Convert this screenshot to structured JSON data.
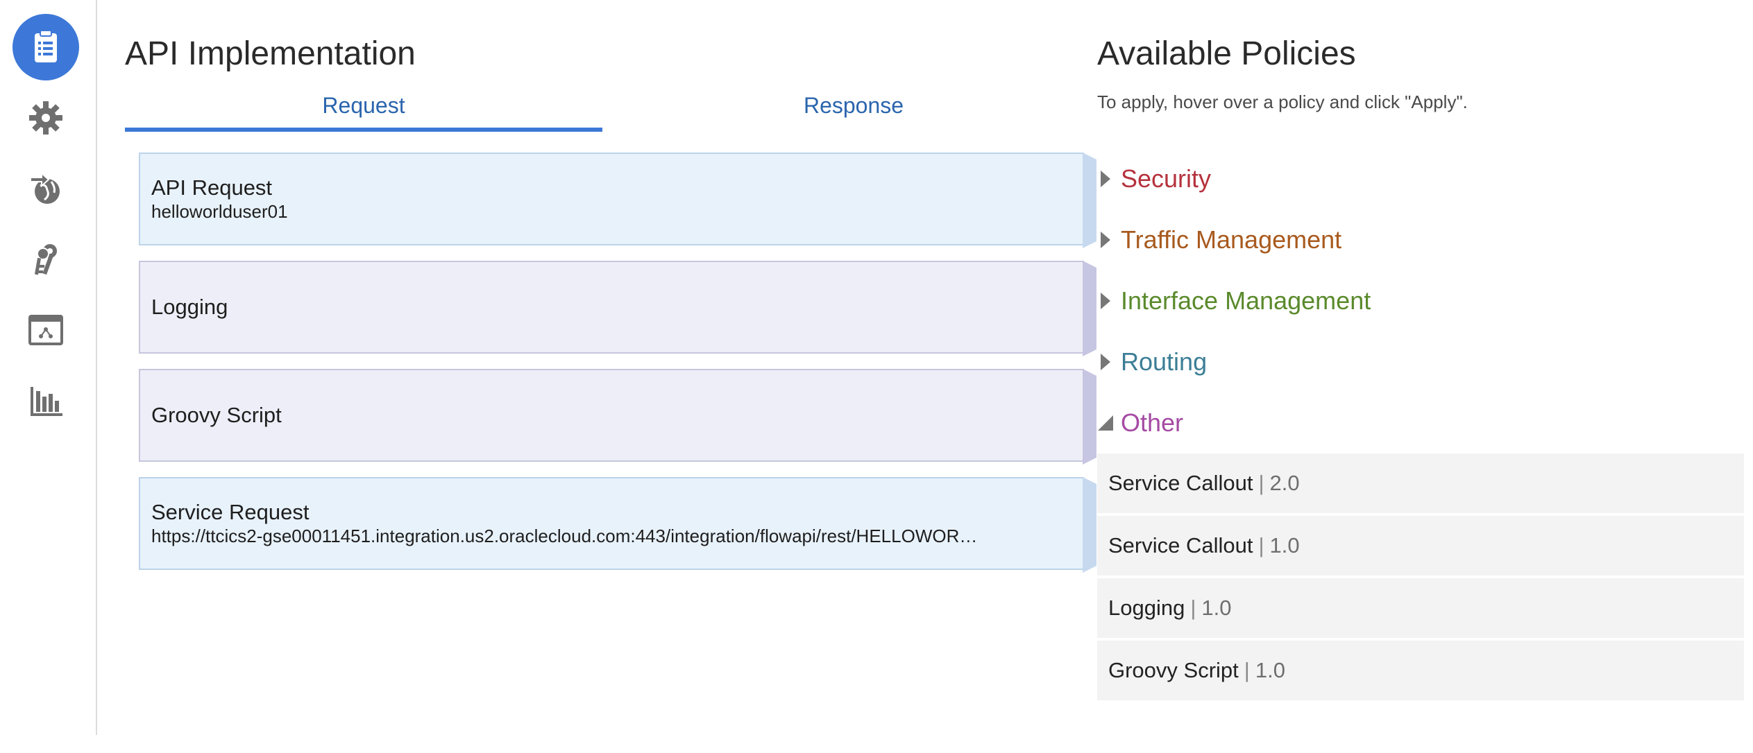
{
  "rail": {
    "items": [
      {
        "icon": "clipboard-list-icon",
        "active": true
      },
      {
        "icon": "gear-icon",
        "active": false
      },
      {
        "icon": "globe-deploy-icon",
        "active": false
      },
      {
        "icon": "keys-icon",
        "active": false
      },
      {
        "icon": "api-portal-icon",
        "active": false
      },
      {
        "icon": "bar-chart-icon",
        "active": false
      }
    ]
  },
  "implementation": {
    "title": "API Implementation",
    "tabs": [
      {
        "label": "Request",
        "active": true
      },
      {
        "label": "Response",
        "active": false
      }
    ],
    "stages": [
      {
        "title": "API Request",
        "subtitle": "helloworlduser01",
        "color": "blue"
      },
      {
        "title": "Logging",
        "subtitle": "",
        "color": "purple"
      },
      {
        "title": "Groovy Script",
        "subtitle": "",
        "color": "purple"
      },
      {
        "title": "Service Request",
        "subtitle": "https://ttcics2-gse00011451.integration.us2.oraclecloud.com:443/integration/flowapi/rest/HELLOWOR…",
        "color": "blue"
      }
    ]
  },
  "policies": {
    "title": "Available Policies",
    "hint": "To apply, hover over a policy and click \"Apply\".",
    "categories": [
      {
        "label": "Security",
        "color": "#b5323d",
        "expanded": false
      },
      {
        "label": "Traffic Management",
        "color": "#a85a1e",
        "expanded": false
      },
      {
        "label": "Interface Management",
        "color": "#5a8a2c",
        "expanded": false
      },
      {
        "label": "Routing",
        "color": "#3c7e96",
        "expanded": false
      },
      {
        "label": "Other",
        "color": "#a54aa3",
        "expanded": true
      }
    ],
    "other_items": [
      {
        "name": "Service Callout",
        "sep": "|",
        "version": "2.0"
      },
      {
        "name": "Service Callout",
        "sep": "|",
        "version": "1.0"
      },
      {
        "name": "Logging",
        "sep": "|",
        "version": "1.0"
      },
      {
        "name": "Groovy Script",
        "sep": "|",
        "version": "1.0"
      }
    ]
  },
  "colors": {
    "accent": "#3d78d8",
    "tab_text": "#2b65ad",
    "rail_icon": "#6f6f6f"
  }
}
